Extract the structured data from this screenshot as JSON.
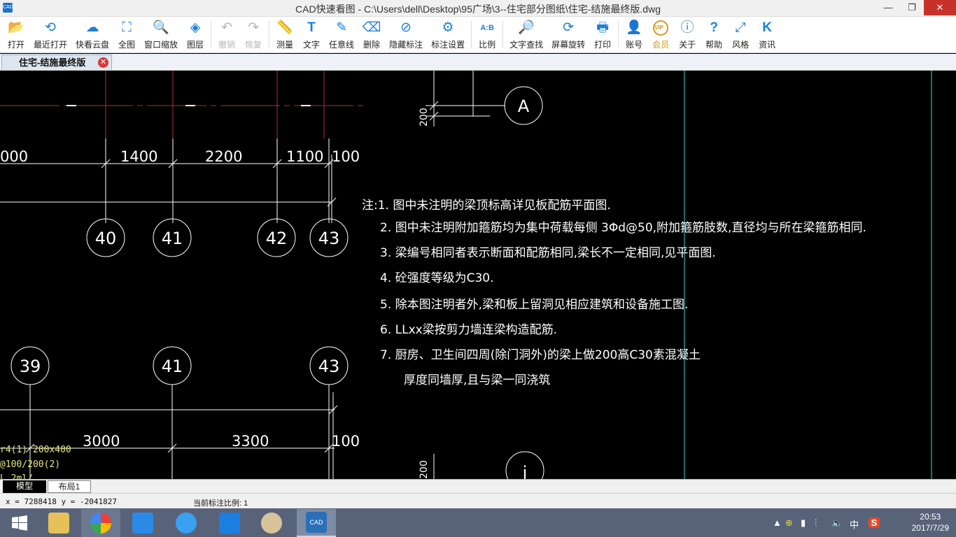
{
  "window": {
    "title": "CAD快速看图 - C:\\Users\\dell\\Desktop\\95广场\\3--住宅部分图纸\\住宅-结施最终版.dwg",
    "app_icon_text": "CAD",
    "minimize": "—",
    "restore": "❐",
    "close": "✕"
  },
  "toolbar": {
    "items": [
      {
        "label": "打开",
        "icon": "folder-open-icon",
        "glyph": "📂"
      },
      {
        "label": "最近打开",
        "icon": "history-icon",
        "glyph": "⟲"
      },
      {
        "label": "快看云盘",
        "icon": "cloud-icon",
        "glyph": "☁"
      },
      {
        "label": "全图",
        "icon": "fullscreen-icon",
        "glyph": "⛶"
      },
      {
        "label": "窗口缩放",
        "icon": "zoom-window-icon",
        "glyph": "🔍"
      },
      {
        "label": "图层",
        "icon": "layers-icon",
        "glyph": "◈"
      },
      {
        "label": "撤销",
        "icon": "undo-icon",
        "glyph": "↶",
        "disabled": true
      },
      {
        "label": "恢复",
        "icon": "redo-icon",
        "glyph": "↷",
        "disabled": true
      },
      {
        "label": "测量",
        "icon": "ruler-icon",
        "glyph": "📏"
      },
      {
        "label": "文字",
        "icon": "text-icon",
        "glyph": "T"
      },
      {
        "label": "任意线",
        "icon": "pen-icon",
        "glyph": "✎"
      },
      {
        "label": "删除",
        "icon": "eraser-icon",
        "glyph": "⌫"
      },
      {
        "label": "隐藏标注",
        "icon": "hide-eye-icon",
        "glyph": "⊘"
      },
      {
        "label": "标注设置",
        "icon": "settings-icon",
        "glyph": "⚙"
      },
      {
        "label": "比例",
        "icon": "scale-icon",
        "glyph": "A:B"
      },
      {
        "label": "文字查找",
        "icon": "text-search-icon",
        "glyph": "🔎"
      },
      {
        "label": "屏幕旋转",
        "icon": "rotate-screen-icon",
        "glyph": "⟳"
      },
      {
        "label": "打印",
        "icon": "printer-icon",
        "glyph": "🖶"
      },
      {
        "label": "账号",
        "icon": "user-icon",
        "glyph": "👤"
      },
      {
        "label": "会员",
        "icon": "vip-icon",
        "glyph": "VIP",
        "vip": true
      },
      {
        "label": "关于",
        "icon": "info-icon",
        "glyph": "ⓘ"
      },
      {
        "label": "帮助",
        "icon": "help-icon",
        "glyph": "?"
      },
      {
        "label": "风格",
        "icon": "style-icon",
        "glyph": "⤢"
      },
      {
        "label": "资讯",
        "icon": "news-icon",
        "glyph": "K"
      }
    ],
    "separators_after": [
      5,
      7,
      13,
      14,
      17
    ]
  },
  "document_tab": {
    "label": "住宅-结施最终版",
    "close": "✕"
  },
  "drawing": {
    "grid_axes_top": [
      "40",
      "41",
      "42",
      "43"
    ],
    "grid_axes_bottom": [
      "39",
      "41",
      "43"
    ],
    "axis_labels": [
      "A",
      "j"
    ],
    "dims_top": [
      "000",
      "1400",
      "2200",
      "1100",
      "100"
    ],
    "dims_bottom": [
      "3000",
      "3300",
      "100"
    ],
    "dims_vertical": [
      "200",
      "200"
    ],
    "beam_notes": [
      "r4(1) 200x400",
      "@100/200(2)",
      "L 2ml/"
    ],
    "notes": [
      "注:1. 图中未注明的梁顶标高详见板配筋平面图.",
      "2. 图中未注明附加箍筋均为集中荷载每侧 3Φd@50,附加箍筋肢数,直径均与所在梁箍筋相同.",
      "3. 梁编号相同者表示断面和配筋相同,梁长不一定相同,见平面图.",
      "4. 砼强度等级为C30.",
      "5. 除本图注明者外,梁和板上留洞见相应建筑和设备施工图.",
      "6. LLxx梁按剪力墙连梁构造配筋.",
      "7. 厨房、卫生间四周(除门洞外)的梁上做200高C30素混凝土",
      "厚度同墙厚,且与梁一同浇筑"
    ]
  },
  "layout_tabs": {
    "model": "模型",
    "layout1": "布局1"
  },
  "status": {
    "coords": "x = 7288418 y = -2041827",
    "scale": "当前标注比例: 1"
  },
  "taskbar": {
    "tray": {
      "ime": "中",
      "sougou": "S",
      "time": "20:53",
      "date": "2017/7/29"
    }
  }
}
